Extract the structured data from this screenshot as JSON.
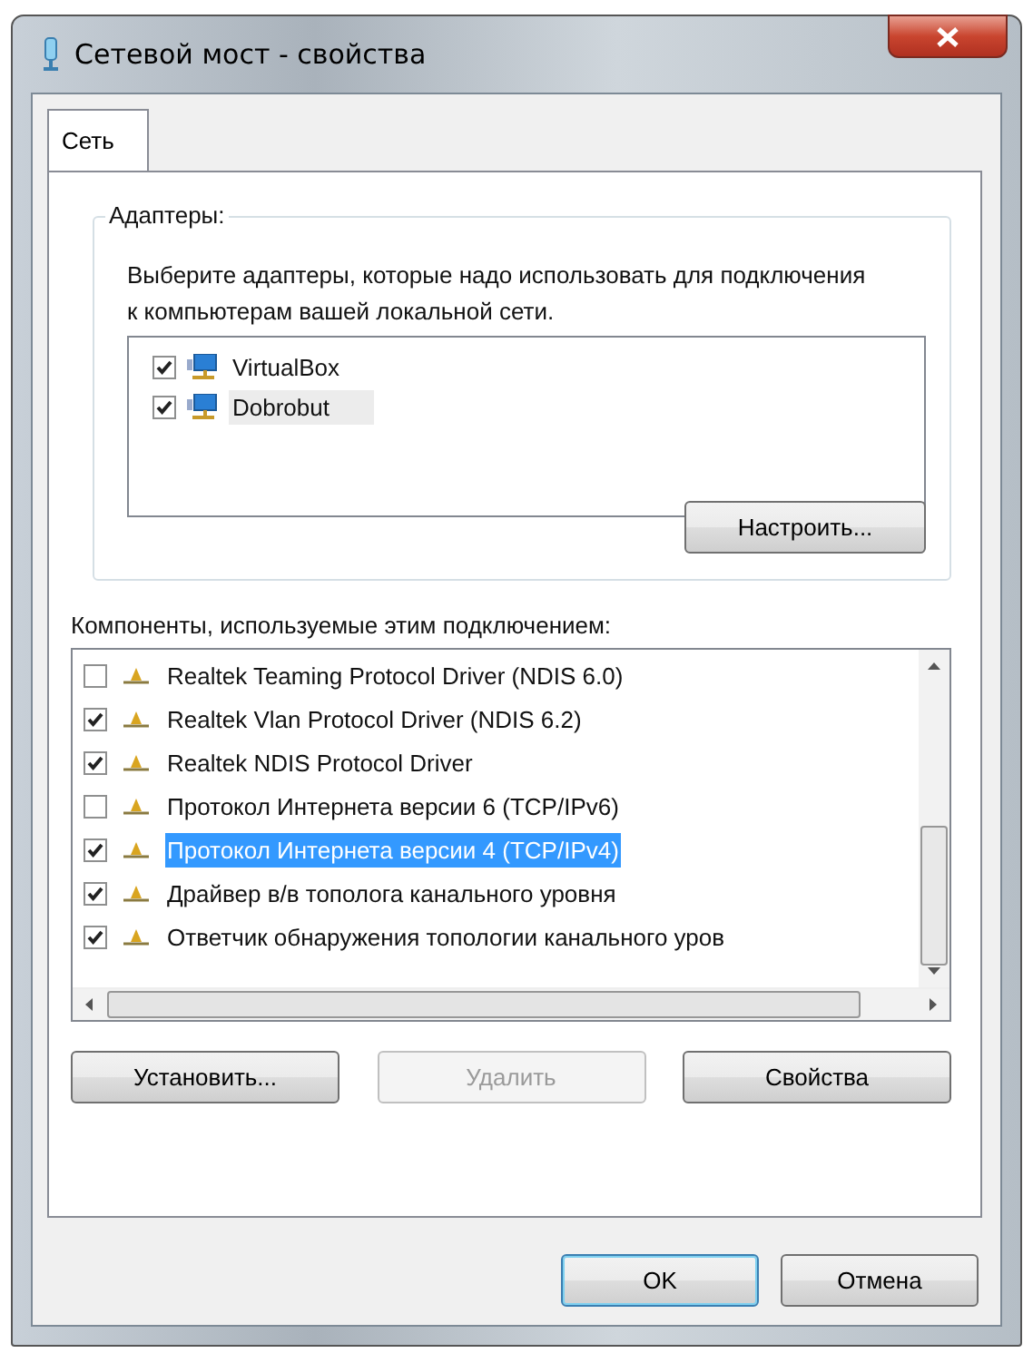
{
  "window": {
    "title": "Сетевой мост - свойства"
  },
  "tabs": [
    {
      "label": "Сеть",
      "selected": true
    }
  ],
  "adapters": {
    "group_label": "Адаптеры:",
    "description": "Выберите адаптеры, которые надо использовать для подключения к компьютерам вашей локальной сети.",
    "items": [
      {
        "label": "VirtualBox",
        "checked": true,
        "selected": false
      },
      {
        "label": "Dobrobut",
        "checked": true,
        "selected": true
      }
    ],
    "configure_button": "Настроить..."
  },
  "components": {
    "label": "Компоненты, используемые этим подключением:",
    "items": [
      {
        "label": "Realtek Teaming Protocol Driver (NDIS 6.0)",
        "checked": false,
        "selected": false
      },
      {
        "label": "Realtek Vlan Protocol Driver (NDIS 6.2)",
        "checked": true,
        "selected": false
      },
      {
        "label": "Realtek NDIS Protocol Driver",
        "checked": true,
        "selected": false
      },
      {
        "label": "Протокол Интернета версии 6 (TCP/IPv6)",
        "checked": false,
        "selected": false
      },
      {
        "label": "Протокол Интернета версии 4 (TCP/IPv4)",
        "checked": true,
        "selected": true
      },
      {
        "label": "Драйвер в/в тополога канального уровня",
        "checked": true,
        "selected": false
      },
      {
        "label": "Ответчик обнаружения топологии канального уров",
        "checked": true,
        "selected": false
      }
    ],
    "buttons": [
      {
        "label": "Установить...",
        "disabled": false
      },
      {
        "label": "Удалить",
        "disabled": true
      },
      {
        "label": "Свойства",
        "disabled": false
      }
    ]
  },
  "dialog_buttons": [
    {
      "label": "OK",
      "default": true
    },
    {
      "label": "Отмена",
      "default": false
    }
  ]
}
